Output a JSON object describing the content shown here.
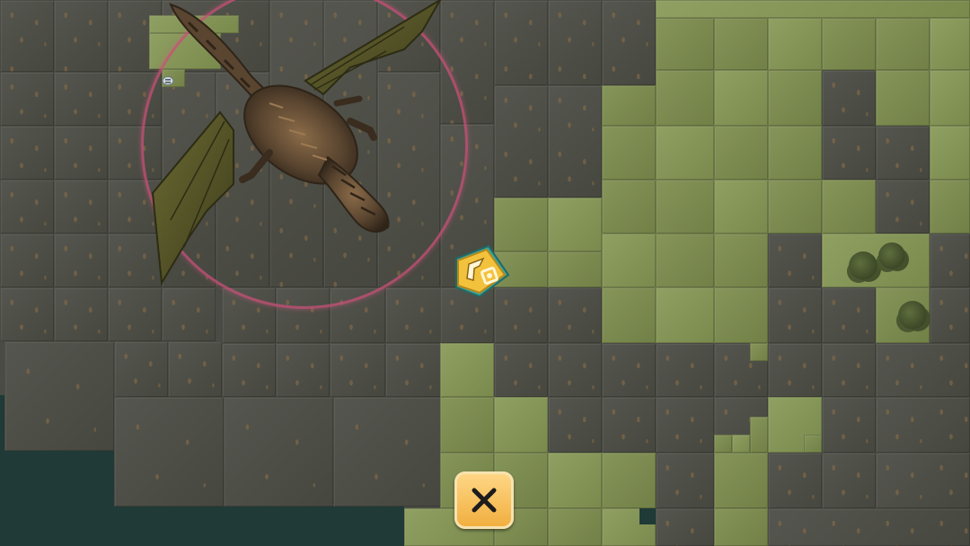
{
  "game": {
    "scene": "overworld-map",
    "entities": [
      {
        "kind": "dragon-enemy",
        "icon": "dragon-icon"
      },
      {
        "kind": "player",
        "icon": "player-marker-icon"
      },
      {
        "kind": "item",
        "icon": "small-item-icon"
      }
    ],
    "detection_ring_color": "#c85078",
    "ui": {
      "close_button_icon": "close-icon",
      "close_button_color": "#f0ad3c"
    },
    "palette": {
      "rock": "#4e4f48",
      "grass": "#7d8c4f",
      "water": "#1f3a37"
    }
  }
}
